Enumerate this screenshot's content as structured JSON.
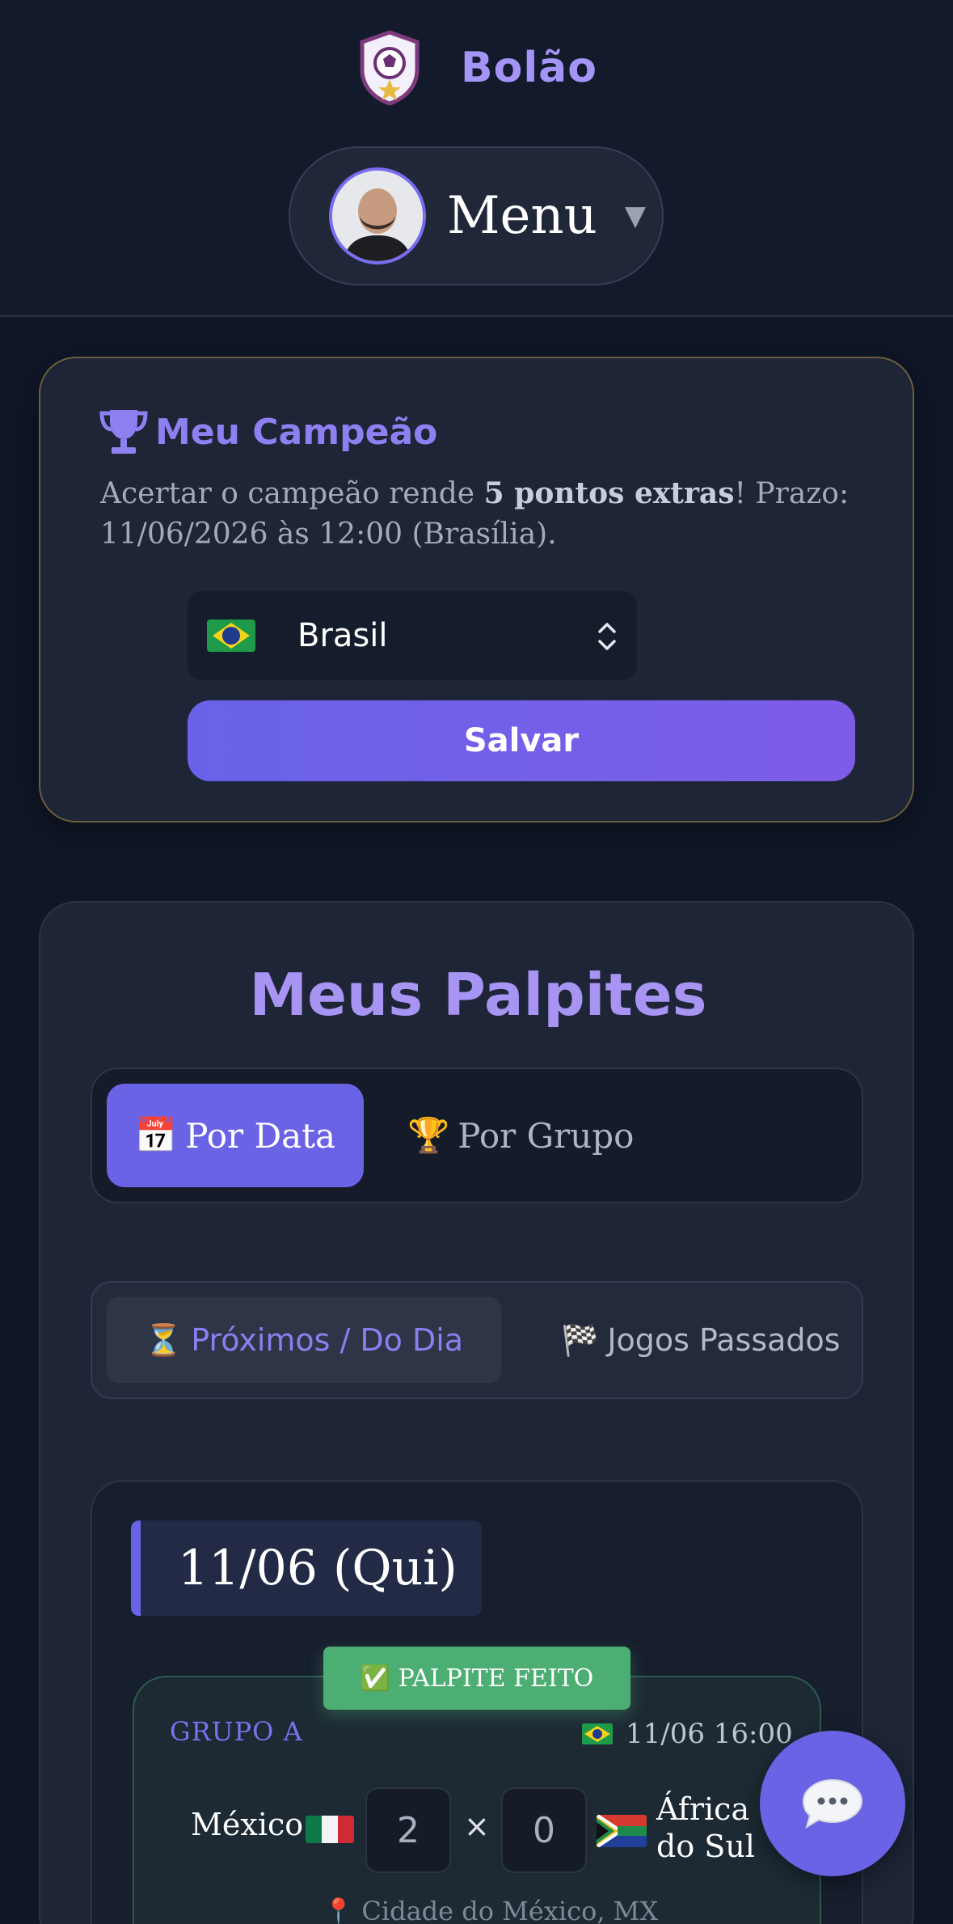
{
  "header": {
    "app_name": "Bolão",
    "menu_label": "Menu",
    "menu_caret": "▼"
  },
  "champion": {
    "title": "Meu Campeão",
    "desc_before": "Acertar o campeão rende ",
    "desc_bold": "5 pontos extras",
    "desc_after": "! Prazo: 11/06/2026 às 12:00 (Brasília).",
    "selected_team": "Brasil",
    "save_label": "Salvar"
  },
  "palpites": {
    "title": "Meus Palpites",
    "view_tabs": [
      {
        "icon": "📅",
        "label": "Por Data",
        "active": true
      },
      {
        "icon": "🏆",
        "label": "Por Grupo",
        "active": false
      }
    ],
    "filter_tabs": [
      {
        "icon": "⏳",
        "label": "Próximos / Do Dia",
        "active": true
      },
      {
        "icon": "🏁",
        "label": "Jogos Passados",
        "active": false
      }
    ],
    "day": {
      "date_label": "11/06 (Qui)",
      "match": {
        "badge": "✅ PALPITE FEITO",
        "group": "GRUPO A",
        "datetime": "11/06 16:00",
        "home_team": "México",
        "away_team_line1": "África",
        "away_team_line2": "do Sul",
        "home_score": "2",
        "away_score": "0",
        "separator": "×",
        "venue": "Cidade do México, MX"
      }
    }
  },
  "chat": {
    "icon": "speech-bubble-icon"
  },
  "colors": {
    "background": "#0f1626",
    "accent": "#6b63e6",
    "accent_text": "#a394f5",
    "success": "#4cae72"
  }
}
